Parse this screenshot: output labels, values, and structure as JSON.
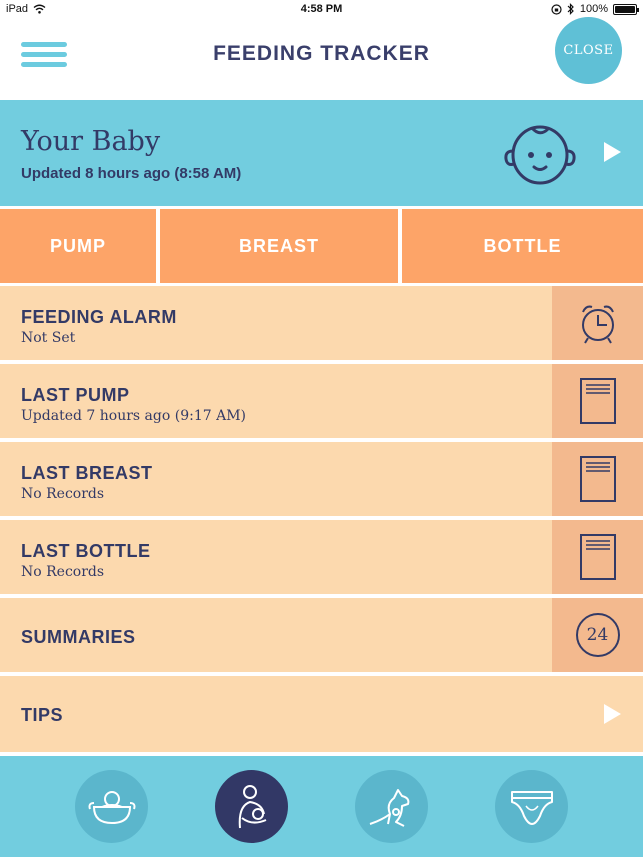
{
  "status_bar": {
    "device": "iPad",
    "time": "4:58 PM",
    "battery": "100%"
  },
  "header": {
    "title": "FEEDING TRACKER",
    "close_label": "CLOSE",
    "menu_icon": "hamburger-menu-icon"
  },
  "baby": {
    "name": "Your Baby",
    "updated": "Updated 8 hours ago (8:58 AM)",
    "icon": "baby-face-icon"
  },
  "tabs": [
    {
      "label": "PUMP"
    },
    {
      "label": "BREAST"
    },
    {
      "label": "BOTTLE"
    }
  ],
  "rows": {
    "alarm": {
      "title": "FEEDING ALARM",
      "subtitle": "Not Set",
      "icon": "alarm-clock-icon"
    },
    "pump": {
      "title": "LAST PUMP",
      "subtitle": "Updated 7 hours ago (9:17 AM)",
      "icon": "notepad-icon"
    },
    "breast": {
      "title": "LAST BREAST",
      "subtitle": "No Records",
      "icon": "notepad-icon"
    },
    "bottle": {
      "title": "LAST BOTTLE",
      "subtitle": "No Records",
      "icon": "notepad-icon"
    },
    "summaries": {
      "title": "SUMMARIES",
      "badge": "24"
    },
    "tips": {
      "title": "TIPS"
    }
  },
  "bottom_nav": [
    {
      "name": "sleep-tab",
      "icon": "sleeping-baby-icon",
      "active": false
    },
    {
      "name": "feeding-tab",
      "icon": "nursing-mother-icon",
      "active": true
    },
    {
      "name": "kangaroo-tab",
      "icon": "kangaroo-icon",
      "active": false
    },
    {
      "name": "diaper-tab",
      "icon": "diaper-icon",
      "active": false
    }
  ],
  "colors": {
    "accent_blue": "#72cddf",
    "orange_tab": "#fda468",
    "row_bg": "#fcd9ae",
    "row_icon_bg": "#f3b98e",
    "navy": "#333a66"
  }
}
